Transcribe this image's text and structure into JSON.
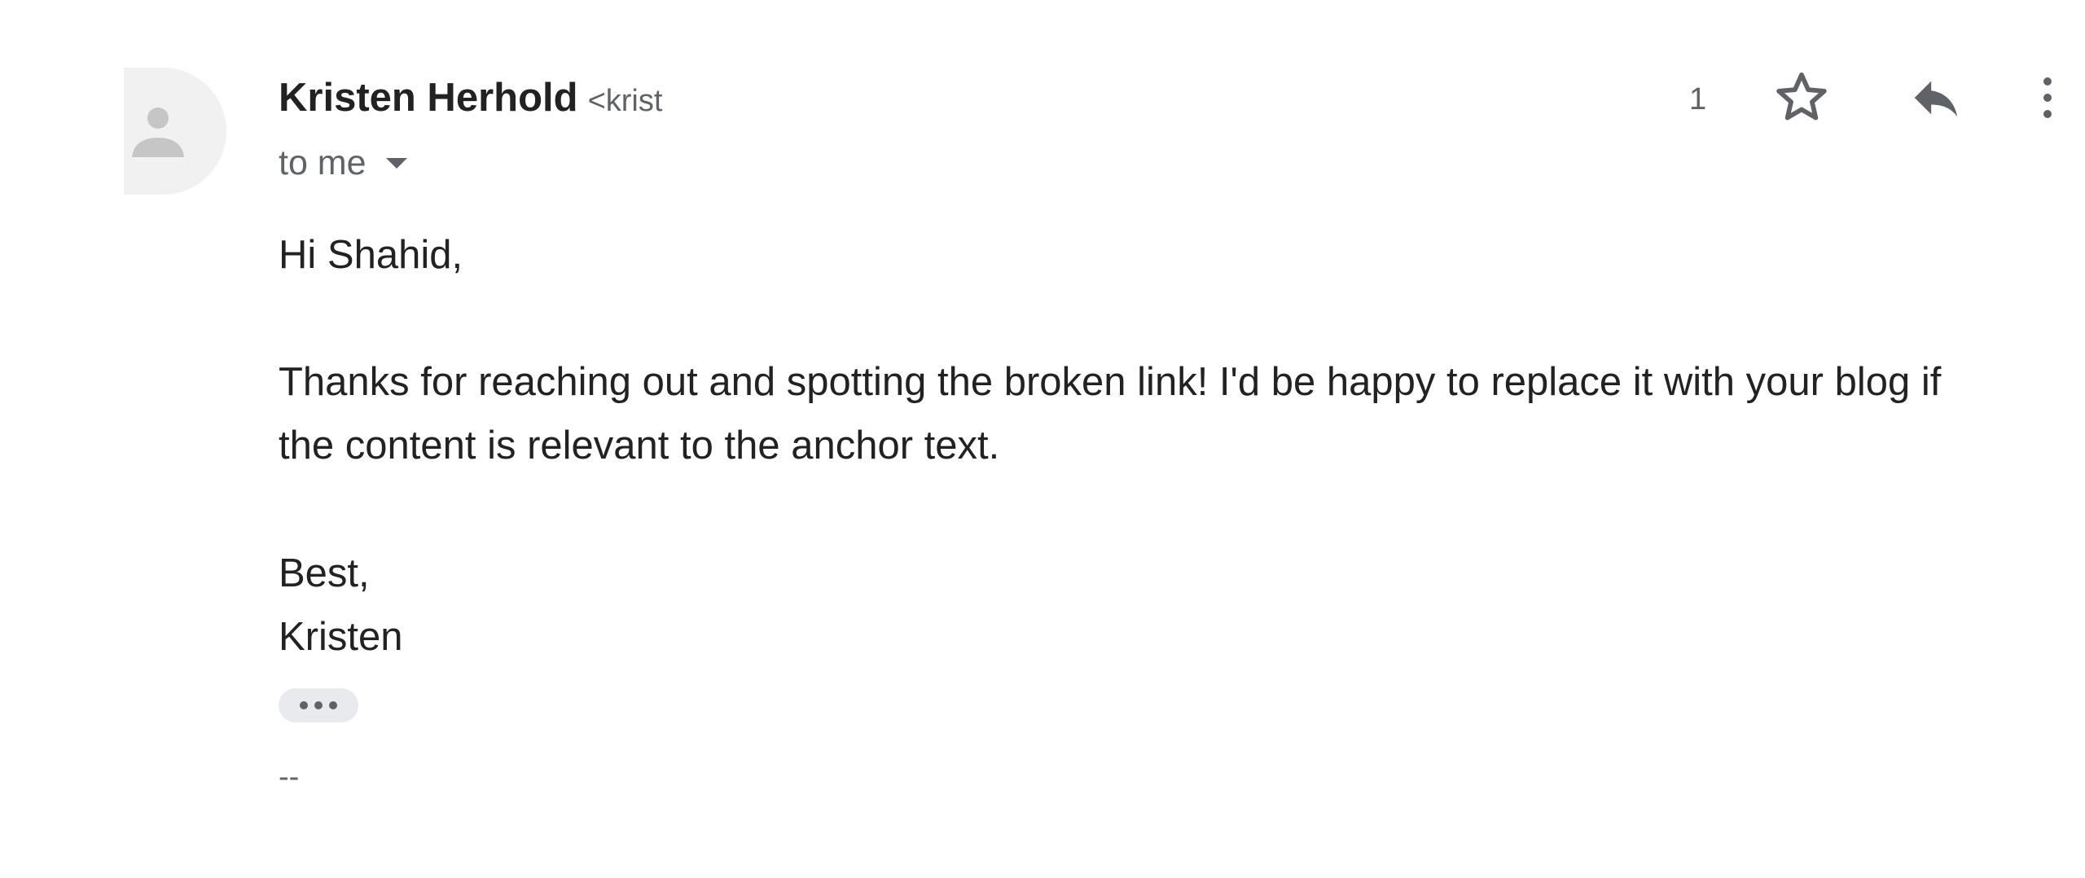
{
  "email": {
    "sender_name": "Kristen Herhold",
    "sender_email_partial": "<krist",
    "recipients_label": "to me",
    "date_partial": "1",
    "body": {
      "greeting": "Hi Shahid,",
      "paragraph_line_1": "Thanks for reaching out and spotting the broken link! I'd be happy to replace it with your blog if",
      "paragraph_line_2": "the content is relevant to the anchor text.",
      "closing": "Best,",
      "signature_name": "Kristen"
    },
    "signature_separator": "--"
  },
  "icons": {
    "avatar": "default-person-icon",
    "recipients_dropdown": "caret-down-icon",
    "star": "star-outline-icon",
    "reply": "reply-icon",
    "more": "more-vertical-icon",
    "trimmed_content": "ellipsis-icon"
  },
  "colors": {
    "primary_text": "#222222",
    "secondary_text": "#5f6368",
    "icon_gray": "#5f6368",
    "avatar_background": "#f1f1f1",
    "avatar_figure": "#c6c6c6",
    "trimmed_pill": "#e8eaed"
  }
}
